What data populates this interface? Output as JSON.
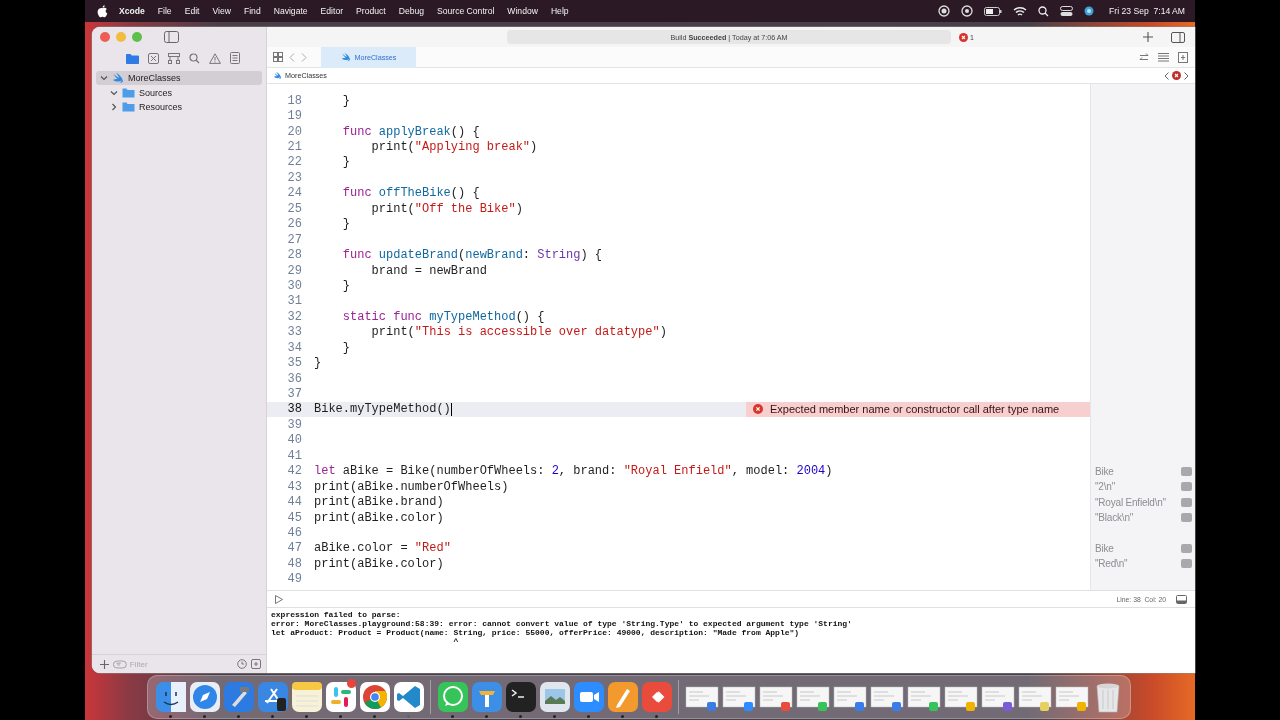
{
  "menu_bar": {
    "app": "Xcode",
    "menus": [
      "File",
      "Edit",
      "View",
      "Find",
      "Navigate",
      "Editor",
      "Product",
      "Debug",
      "Source Control",
      "Window",
      "Help"
    ],
    "clock": "Fri 23 Sep  7:14 AM"
  },
  "navigator": {
    "tabs": [
      {
        "kind": "folder",
        "selected": true
      },
      {
        "kind": "source-control",
        "selected": false
      },
      {
        "kind": "hierarchy",
        "selected": false
      },
      {
        "kind": "search",
        "selected": false
      },
      {
        "kind": "warning",
        "selected": false
      },
      {
        "kind": "list",
        "selected": false
      }
    ],
    "tree": [
      {
        "label": "MoreClasses",
        "kind": "playground",
        "expanded": true,
        "selected": true,
        "children": [
          {
            "label": "Sources",
            "kind": "folder",
            "expanded": true,
            "selected": false
          },
          {
            "label": "Resources",
            "kind": "folder",
            "expanded": false,
            "selected": false
          }
        ]
      }
    ],
    "filter": {
      "placeholder": "Filter"
    }
  },
  "toolbar": {
    "status": "Build **Succeeded** | Today at 7:06 AM",
    "error_count": "1"
  },
  "tabs": [
    {
      "label": "MoreClasses",
      "selected": true
    }
  ],
  "jump_bar": {
    "crumb": "MoreClasses"
  },
  "editor": {
    "lines": [
      {
        "n": "18",
        "current": false,
        "code": [
          {
            "t": "    }",
            "kind": "plain"
          }
        ]
      },
      {
        "n": "19",
        "current": false
      },
      {
        "n": "20",
        "current": false,
        "code": [
          {
            "t": "    func",
            "kind": "keyword"
          },
          {
            "t": " applyBreak",
            "kind": "decl"
          },
          {
            "t": "() {",
            "kind": "plain"
          }
        ]
      },
      {
        "n": "21",
        "current": false,
        "code": [
          {
            "t": "        print(",
            "kind": "plain"
          },
          {
            "t": "\"Applying break\"",
            "kind": "string"
          },
          {
            "t": ")",
            "kind": "plain"
          }
        ]
      },
      {
        "n": "22",
        "current": false,
        "code": [
          {
            "t": "    }",
            "kind": "plain"
          }
        ]
      },
      {
        "n": "23",
        "current": false
      },
      {
        "n": "24",
        "current": false,
        "code": [
          {
            "t": "    func",
            "kind": "keyword"
          },
          {
            "t": " offTheBike",
            "kind": "decl"
          },
          {
            "t": "() {",
            "kind": "plain"
          }
        ]
      },
      {
        "n": "25",
        "current": false,
        "code": [
          {
            "t": "        print(",
            "kind": "plain"
          },
          {
            "t": "\"Off the Bike\"",
            "kind": "string"
          },
          {
            "t": ")",
            "kind": "plain"
          }
        ]
      },
      {
        "n": "26",
        "current": false,
        "code": [
          {
            "t": "    }",
            "kind": "plain"
          }
        ]
      },
      {
        "n": "27",
        "current": false
      },
      {
        "n": "28",
        "current": false,
        "code": [
          {
            "t": "    func",
            "kind": "keyword"
          },
          {
            "t": " updateBrand",
            "kind": "decl"
          },
          {
            "t": "(",
            "kind": "plain"
          },
          {
            "t": "newBrand",
            "kind": "decl"
          },
          {
            "t": ": ",
            "kind": "plain"
          },
          {
            "t": "String",
            "kind": "type"
          },
          {
            "t": ") {",
            "kind": "plain"
          }
        ]
      },
      {
        "n": "29",
        "current": false,
        "code": [
          {
            "t": "        brand = newBrand",
            "kind": "plain"
          }
        ]
      },
      {
        "n": "30",
        "current": false,
        "code": [
          {
            "t": "    }",
            "kind": "plain"
          }
        ]
      },
      {
        "n": "31",
        "current": false
      },
      {
        "n": "32",
        "current": false,
        "code": [
          {
            "t": "    static func",
            "kind": "keyword"
          },
          {
            "t": " myTypeMethod",
            "kind": "decl"
          },
          {
            "t": "() {",
            "kind": "plain"
          }
        ]
      },
      {
        "n": "33",
        "current": false,
        "code": [
          {
            "t": "        print(",
            "kind": "plain"
          },
          {
            "t": "\"This is accessible over datatype\"",
            "kind": "string"
          },
          {
            "t": ")",
            "kind": "plain"
          }
        ]
      },
      {
        "n": "34",
        "current": false,
        "code": [
          {
            "t": "    }",
            "kind": "plain"
          }
        ]
      },
      {
        "n": "35",
        "current": false,
        "code": [
          {
            "t": "}",
            "kind": "plain"
          }
        ]
      },
      {
        "n": "36",
        "current": false
      },
      {
        "n": "37",
        "current": false
      },
      {
        "n": "38",
        "current": true,
        "code": [
          {
            "t": "Bike.myTypeMethod()",
            "kind": "plain"
          }
        ],
        "error": "Expected member name or constructor call after type name"
      },
      {
        "n": "39",
        "current": false
      },
      {
        "n": "40",
        "current": false
      },
      {
        "n": "41",
        "current": false
      },
      {
        "n": "42",
        "current": false,
        "code": [
          {
            "t": "let",
            "kind": "keyword"
          },
          {
            "t": " aBike = Bike(numberOfWheels: ",
            "kind": "plain"
          },
          {
            "t": "2",
            "kind": "number"
          },
          {
            "t": ", brand: ",
            "kind": "plain"
          },
          {
            "t": "\"Royal Enfield\"",
            "kind": "string"
          },
          {
            "t": ", model: ",
            "kind": "plain"
          },
          {
            "t": "2004",
            "kind": "number"
          },
          {
            "t": ")",
            "kind": "plain"
          }
        ],
        "result": "Bike"
      },
      {
        "n": "43",
        "current": false,
        "code": [
          {
            "t": "print(aBike.numberOfWheels)",
            "kind": "plain"
          }
        ],
        "result": "\"2\\n\""
      },
      {
        "n": "44",
        "current": false,
        "code": [
          {
            "t": "print(aBike.brand)",
            "kind": "plain"
          }
        ],
        "result": "\"Royal Enfield\\n\""
      },
      {
        "n": "45",
        "current": false,
        "code": [
          {
            "t": "print(aBike.color)",
            "kind": "plain"
          }
        ],
        "result": "\"Black\\n\""
      },
      {
        "n": "46",
        "current": false
      },
      {
        "n": "47",
        "current": false,
        "code": [
          {
            "t": "aBike.color = ",
            "kind": "plain"
          },
          {
            "t": "\"Red\"",
            "kind": "string"
          }
        ],
        "result": "Bike"
      },
      {
        "n": "48",
        "current": false,
        "code": [
          {
            "t": "print(aBike.color)",
            "kind": "plain"
          }
        ],
        "result": "\"Red\\n\""
      },
      {
        "n": "49",
        "current": false
      }
    ]
  },
  "status_bar": {
    "position": "Line: 38  Col: 20"
  },
  "console": {
    "lines": [
      "expression failed to parse:",
      "error: MoreClasses.playground:58:39: error: cannot convert value of type 'String.Type' to expected argument type 'String'",
      "let aProduct: Product = Product(name: String, price: 55000, offerPrice: 49000, description: \"Made from Apple\")",
      "                                      ^"
    ]
  },
  "dock": {
    "items": [
      {
        "kind": "finder",
        "running": true
      },
      {
        "kind": "safari",
        "running": true
      },
      {
        "kind": "xcode",
        "running": true
      },
      {
        "kind": "simulator",
        "running": true
      },
      {
        "kind": "notes",
        "running": true
      },
      {
        "kind": "slack",
        "running": true,
        "badge": true
      },
      {
        "kind": "chrome",
        "running": true
      },
      {
        "kind": "vscode",
        "running": false
      },
      {
        "kind": "divider"
      },
      {
        "kind": "whatsapp",
        "running": true
      },
      {
        "kind": "keynote",
        "running": true
      },
      {
        "kind": "terminal",
        "running": true
      },
      {
        "kind": "preview",
        "running": true
      },
      {
        "kind": "zoom",
        "running": true
      },
      {
        "kind": "pages",
        "running": true
      },
      {
        "kind": "anydesk",
        "running": true
      },
      {
        "kind": "divider"
      },
      {
        "kind": "window"
      },
      {
        "kind": "window"
      },
      {
        "kind": "window"
      },
      {
        "kind": "window"
      },
      {
        "kind": "window"
      },
      {
        "kind": "window"
      },
      {
        "kind": "window"
      },
      {
        "kind": "window"
      },
      {
        "kind": "window"
      },
      {
        "kind": "window"
      },
      {
        "kind": "window"
      },
      {
        "kind": "trash"
      }
    ]
  }
}
